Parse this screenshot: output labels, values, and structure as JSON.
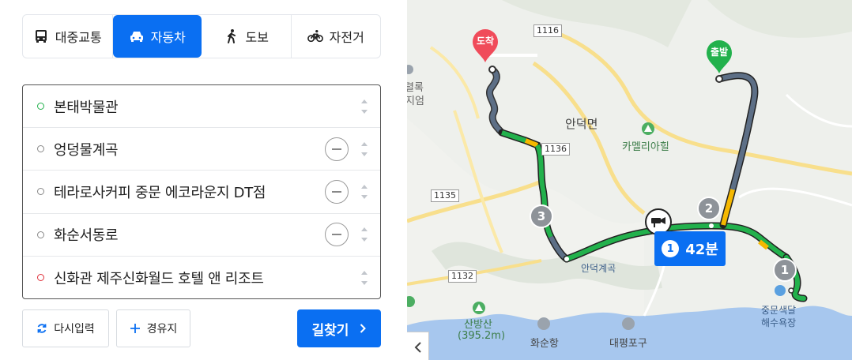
{
  "modes": [
    {
      "label": "대중교통",
      "icon": "bus-icon",
      "active": false
    },
    {
      "label": "자동차",
      "icon": "car-icon",
      "active": true
    },
    {
      "label": "도보",
      "icon": "walk-icon",
      "active": false
    },
    {
      "label": "자전거",
      "icon": "bicycle-icon",
      "active": false
    }
  ],
  "stops": [
    {
      "label": "본태박물관",
      "type": "start"
    },
    {
      "label": "엉덩물계곡",
      "type": "waypoint"
    },
    {
      "label": "테라로사커피 중문 에코라운지 DT점",
      "type": "waypoint"
    },
    {
      "label": "화순서동로",
      "type": "waypoint"
    },
    {
      "label": "신화관 제주신화월드 호텔 앤 리조트",
      "type": "end"
    }
  ],
  "actions": {
    "reset_label": "다시입력",
    "waypoint_label": "경유지",
    "search_label": "길찾기"
  },
  "map": {
    "pin_end": "도착",
    "pin_start": "출발",
    "route_time_index": "1",
    "route_time": "42분",
    "segment_numbers": [
      "1",
      "2",
      "3"
    ],
    "road_numbers": [
      "1116",
      "1136",
      "1135",
      "1132"
    ],
    "places": {
      "andeok": "안덕면",
      "camellia": "카멜리아힐",
      "andeok_valley": "안덕계곡",
      "sanbangsan": "산방산",
      "sanbangsan_height": "(395.2m)",
      "hwasun_port": "화순항",
      "daepyeong_port": "대평포구",
      "jungmun_beach_1": "중문색달",
      "jungmun_beach_2": "해수욕장",
      "partial_1": "렬록",
      "partial_2": "지엄"
    },
    "colors": {
      "route_green": "#22b14c",
      "route_slow": "#5d6f86",
      "route_orange": "#f5b800",
      "accent_blue": "#0a6ff2"
    }
  }
}
